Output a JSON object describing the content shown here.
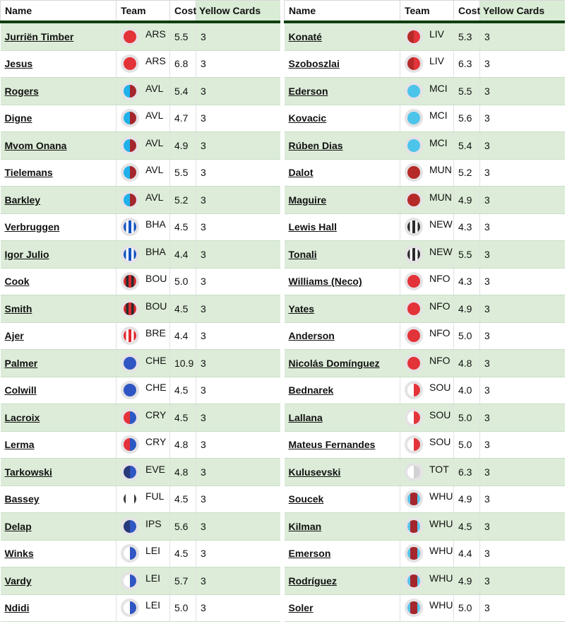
{
  "headers": {
    "name": "Name",
    "team": "Team",
    "cost": "Cost",
    "yellow_cards": "Yellow Cards"
  },
  "kit_styles": {
    "ARS": {
      "type": "solid",
      "colors": [
        "#e33238"
      ]
    },
    "AVL": {
      "type": "split",
      "colors": [
        "#1fb1e9",
        "#a4262c"
      ]
    },
    "BHA": {
      "type": "stripes",
      "colors": [
        "#ffffff",
        "#1353c2"
      ]
    },
    "BOU": {
      "type": "stripes",
      "colors": [
        "#2b2b2b",
        "#d8282e"
      ]
    },
    "BRE": {
      "type": "stripes",
      "colors": [
        "#ffffff",
        "#e2272e"
      ]
    },
    "CHE": {
      "type": "solid",
      "colors": [
        "#2f56c2"
      ]
    },
    "CRY": {
      "type": "split",
      "colors": [
        "#e5313a",
        "#2b58c4"
      ]
    },
    "EVE": {
      "type": "split",
      "colors": [
        "#263a78",
        "#2f56c2"
      ]
    },
    "FUL": {
      "type": "edges",
      "colors": [
        "#ffffff",
        "#3a3a3a"
      ]
    },
    "IPS": {
      "type": "split",
      "colors": [
        "#263a78",
        "#2f56c2"
      ]
    },
    "LEI": {
      "type": "split",
      "colors": [
        "#ffffff",
        "#2f56c2"
      ]
    },
    "LIV": {
      "type": "split",
      "colors": [
        "#b52a28",
        "#e2343a"
      ]
    },
    "MCI": {
      "type": "solid",
      "colors": [
        "#4dc4ea"
      ]
    },
    "MUN": {
      "type": "solid",
      "colors": [
        "#b52a28"
      ]
    },
    "NEW": {
      "type": "stripes",
      "colors": [
        "#ffffff",
        "#2b2b2b"
      ]
    },
    "NFO": {
      "type": "solid",
      "colors": [
        "#e23339"
      ]
    },
    "SOU": {
      "type": "split",
      "colors": [
        "#ffffff",
        "#e2343a"
      ]
    },
    "TOT": {
      "type": "split",
      "colors": [
        "#ffffff",
        "#d2d2d4"
      ]
    },
    "WHU": {
      "type": "center",
      "colors": [
        "#58c4ea",
        "#a4262c"
      ]
    }
  },
  "left_table": [
    {
      "name": "Jurriën Timber",
      "team": "ARS",
      "cost": "5.5",
      "yellow_cards": "3"
    },
    {
      "name": "Jesus",
      "team": "ARS",
      "cost": "6.8",
      "yellow_cards": "3"
    },
    {
      "name": "Rogers",
      "team": "AVL",
      "cost": "5.4",
      "yellow_cards": "3"
    },
    {
      "name": "Digne",
      "team": "AVL",
      "cost": "4.7",
      "yellow_cards": "3"
    },
    {
      "name": "Mvom Onana",
      "team": "AVL",
      "cost": "4.9",
      "yellow_cards": "3"
    },
    {
      "name": "Tielemans",
      "team": "AVL",
      "cost": "5.5",
      "yellow_cards": "3"
    },
    {
      "name": "Barkley",
      "team": "AVL",
      "cost": "5.2",
      "yellow_cards": "3"
    },
    {
      "name": "Verbruggen",
      "team": "BHA",
      "cost": "4.5",
      "yellow_cards": "3"
    },
    {
      "name": "Igor Julio",
      "team": "BHA",
      "cost": "4.4",
      "yellow_cards": "3"
    },
    {
      "name": "Cook",
      "team": "BOU",
      "cost": "5.0",
      "yellow_cards": "3"
    },
    {
      "name": "Smith",
      "team": "BOU",
      "cost": "4.5",
      "yellow_cards": "3"
    },
    {
      "name": "Ajer",
      "team": "BRE",
      "cost": "4.4",
      "yellow_cards": "3"
    },
    {
      "name": "Palmer",
      "team": "CHE",
      "cost": "10.9",
      "yellow_cards": "3"
    },
    {
      "name": "Colwill",
      "team": "CHE",
      "cost": "4.5",
      "yellow_cards": "3"
    },
    {
      "name": "Lacroix",
      "team": "CRY",
      "cost": "4.5",
      "yellow_cards": "3"
    },
    {
      "name": "Lerma",
      "team": "CRY",
      "cost": "4.8",
      "yellow_cards": "3"
    },
    {
      "name": "Tarkowski",
      "team": "EVE",
      "cost": "4.8",
      "yellow_cards": "3"
    },
    {
      "name": "Bassey",
      "team": "FUL",
      "cost": "4.5",
      "yellow_cards": "3"
    },
    {
      "name": "Delap",
      "team": "IPS",
      "cost": "5.6",
      "yellow_cards": "3"
    },
    {
      "name": "Winks",
      "team": "LEI",
      "cost": "4.5",
      "yellow_cards": "3"
    },
    {
      "name": "Vardy",
      "team": "LEI",
      "cost": "5.7",
      "yellow_cards": "3"
    },
    {
      "name": "Ndidi",
      "team": "LEI",
      "cost": "5.0",
      "yellow_cards": "3"
    }
  ],
  "right_table": [
    {
      "name": "Konaté",
      "team": "LIV",
      "cost": "5.3",
      "yellow_cards": "3"
    },
    {
      "name": "Szoboszlai",
      "team": "LIV",
      "cost": "6.3",
      "yellow_cards": "3"
    },
    {
      "name": "Ederson",
      "team": "MCI",
      "cost": "5.5",
      "yellow_cards": "3"
    },
    {
      "name": "Kovacic",
      "team": "MCI",
      "cost": "5.6",
      "yellow_cards": "3"
    },
    {
      "name": "Rúben Dias",
      "team": "MCI",
      "cost": "5.4",
      "yellow_cards": "3"
    },
    {
      "name": "Dalot",
      "team": "MUN",
      "cost": "5.2",
      "yellow_cards": "3"
    },
    {
      "name": "Maguire",
      "team": "MUN",
      "cost": "4.9",
      "yellow_cards": "3"
    },
    {
      "name": "Lewis Hall",
      "team": "NEW",
      "cost": "4.3",
      "yellow_cards": "3"
    },
    {
      "name": "Tonali",
      "team": "NEW",
      "cost": "5.5",
      "yellow_cards": "3"
    },
    {
      "name": "Williams (Neco)",
      "team": "NFO",
      "cost": "4.3",
      "yellow_cards": "3"
    },
    {
      "name": "Yates",
      "team": "NFO",
      "cost": "4.9",
      "yellow_cards": "3"
    },
    {
      "name": "Anderson",
      "team": "NFO",
      "cost": "5.0",
      "yellow_cards": "3"
    },
    {
      "name": "Nicolás Domínguez",
      "team": "NFO",
      "cost": "4.8",
      "yellow_cards": "3"
    },
    {
      "name": "Bednarek",
      "team": "SOU",
      "cost": "4.0",
      "yellow_cards": "3"
    },
    {
      "name": "Lallana",
      "team": "SOU",
      "cost": "5.0",
      "yellow_cards": "3"
    },
    {
      "name": "Mateus Fernandes",
      "team": "SOU",
      "cost": "5.0",
      "yellow_cards": "3"
    },
    {
      "name": "Kulusevski",
      "team": "TOT",
      "cost": "6.3",
      "yellow_cards": "3"
    },
    {
      "name": "Soucek",
      "team": "WHU",
      "cost": "4.9",
      "yellow_cards": "3"
    },
    {
      "name": "Kilman",
      "team": "WHU",
      "cost": "4.5",
      "yellow_cards": "3"
    },
    {
      "name": "Emerson",
      "team": "WHU",
      "cost": "4.4",
      "yellow_cards": "3"
    },
    {
      "name": "Rodríguez",
      "team": "WHU",
      "cost": "4.9",
      "yellow_cards": "3"
    },
    {
      "name": "Soler",
      "team": "WHU",
      "cost": "5.0",
      "yellow_cards": "3"
    }
  ]
}
